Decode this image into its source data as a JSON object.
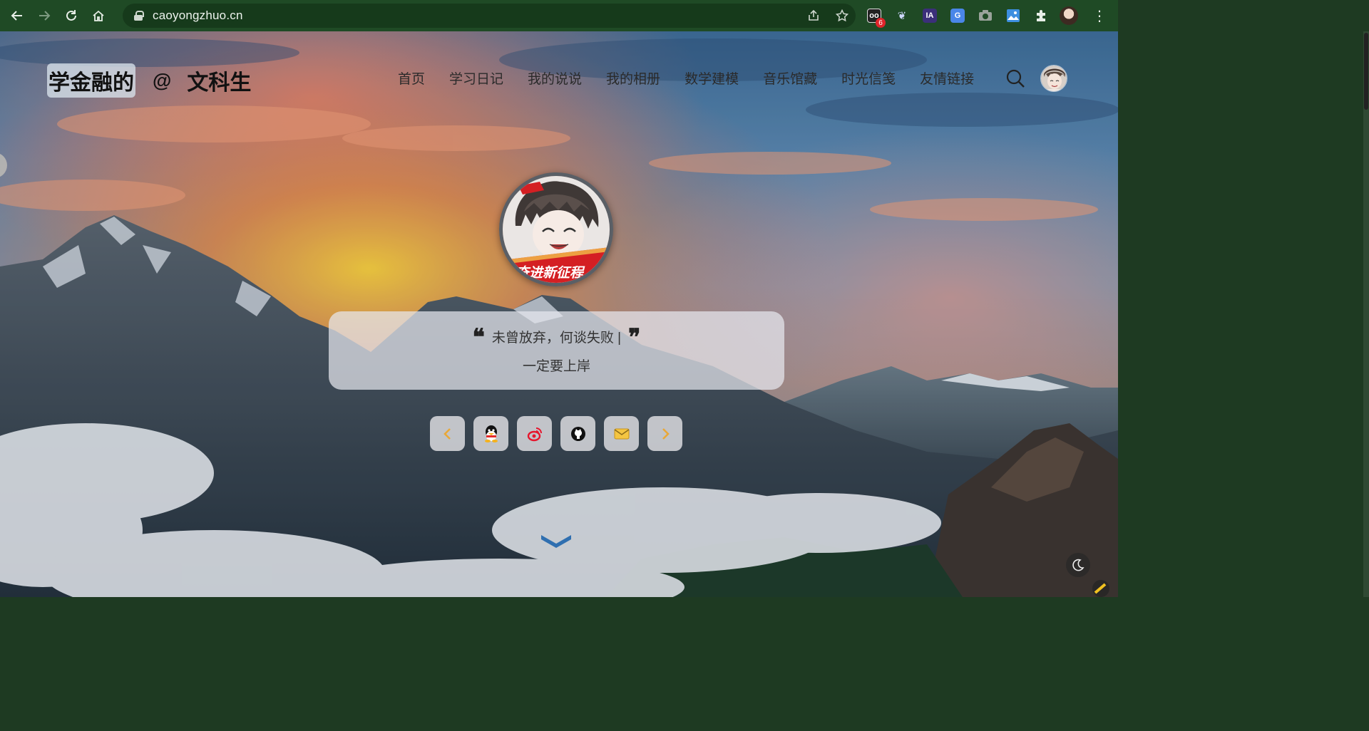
{
  "browser": {
    "url": "caoyongzhuo.cn",
    "extension_badge_count": "6",
    "ia_label": "IA",
    "translate_label": "G"
  },
  "site": {
    "title_left": "学金融的",
    "title_at": "@",
    "title_right": "文科生"
  },
  "nav": {
    "items": [
      "首页",
      "学习日记",
      "我的说说",
      "我的相册",
      "数学建模",
      "音乐馆藏",
      "时光信笺",
      "友情链接"
    ]
  },
  "hero": {
    "quote": "未曾放弃，何谈失败 |",
    "subtitle": "一定要上岸",
    "avatar_banner_text": "奋进新征程"
  },
  "social": {
    "buttons": [
      "chevron-left-icon",
      "qq-icon",
      "weibo-icon",
      "github-icon",
      "mail-icon",
      "chevron-right-icon"
    ],
    "accent_color": "#e9a838"
  },
  "colors": {
    "chrome_bg": "#1f4a25",
    "nav_text": "#2a2a2a",
    "scroll_chevron": "#2f6fb0"
  }
}
